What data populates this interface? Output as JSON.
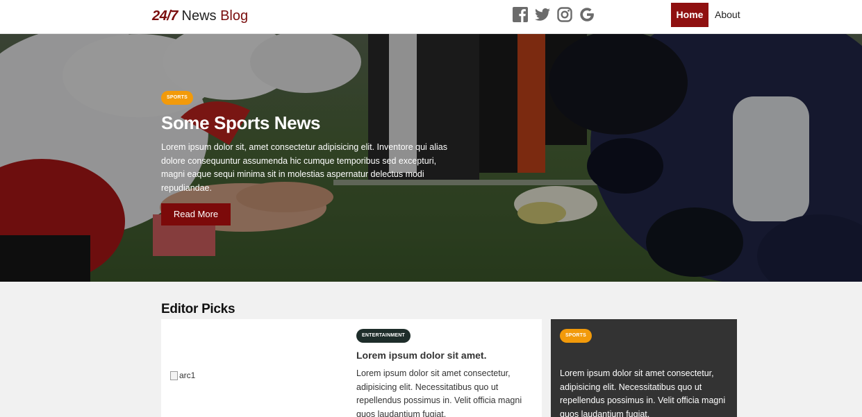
{
  "header": {
    "logo": {
      "part1": "24/7",
      "part2": "News",
      "part3": "Blog"
    },
    "social": [
      "facebook-icon",
      "twitter-icon",
      "instagram-icon",
      "google-icon"
    ],
    "nav": {
      "home": "Home",
      "about": "About"
    }
  },
  "hero": {
    "category": "SPORTS",
    "title": "Some Sports News",
    "text": "Lorem ipsum dolor sit, amet consectetur adipisicing elit. Inventore qui alias dolore consequuntur assumenda hic cumque temporibus sed excepturi, magni eaque sequi minima sit in molestias aspernatur delectus modi repudiandae.",
    "button": "Read More"
  },
  "editor_picks": {
    "title": "Editor Picks",
    "main_card": {
      "image_alt": "arc1",
      "category": "ENTERTAINMENT",
      "headline": "Lorem ipsum dolor sit amet.",
      "text": "Lorem ipsum dolor sit amet consectetur, adipisicing elit. Necessitatibus quo ut repellendus possimus in. Velit officia magni quos laudantium fugiat."
    },
    "side_card": {
      "category": "SPORTS",
      "text": "Lorem ipsum dolor sit amet consectetur, adipisicing elit. Necessitatibus quo ut repellendus possimus in. Velit officia magni quos laudantium fugiat."
    }
  },
  "colors": {
    "brand_red": "#8f1010",
    "button_red": "#7c0a0a",
    "badge_orange": "#f29a0a",
    "badge_dark": "#1e2d2a",
    "side_card_bg": "#333333"
  }
}
